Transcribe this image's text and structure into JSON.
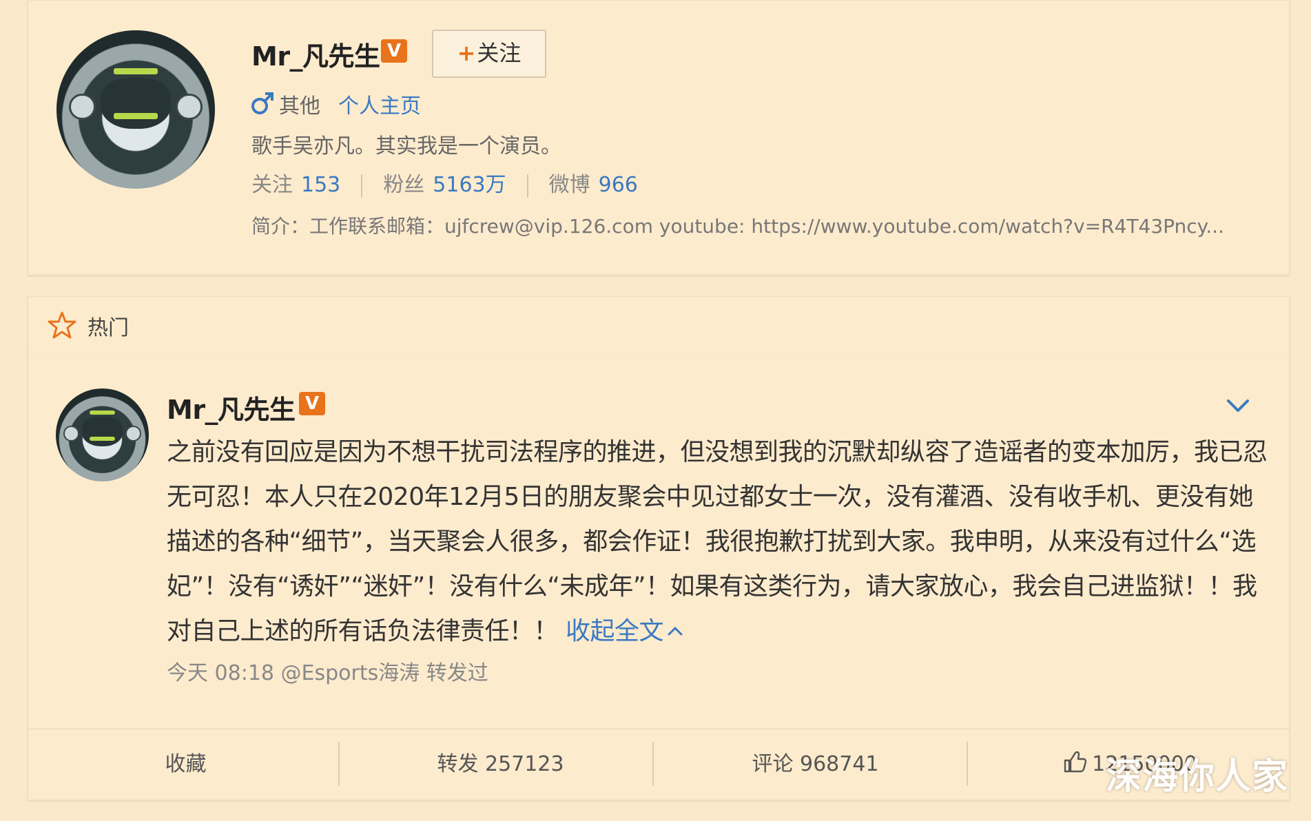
{
  "profile": {
    "name": "Mr_凡先生",
    "verified_badge": "V",
    "follow_button": {
      "plus": "+",
      "label": "关注"
    },
    "gender_icon": "male-icon",
    "gender_label": "其他",
    "homepage_link": "个人主页",
    "description": "歌手吴亦凡。其实我是一个演员。",
    "stats": [
      {
        "label": "关注",
        "value": "153"
      },
      {
        "label": "粉丝",
        "value": "5163万"
      },
      {
        "label": "微博",
        "value": "966"
      }
    ],
    "bio": "简介：工作联系邮箱：ujfcrew@vip.126.com youtube: https://www.youtube.com/watch?v=R4T43Pncy..."
  },
  "hot_section": {
    "icon": "star-icon",
    "label": "热门"
  },
  "post": {
    "author": "Mr_凡先生",
    "verified_badge": "V",
    "text": "之前没有回应是因为不想干扰司法程序的推进，但没想到我的沉默却纵容了造谣者的变本加厉，我已忍无可忍！本人只在2020年12月5日的朋友聚会中见过都女士一次，没有灌酒、没有收手机、更没有她描述的各种“细节”，当天聚会人很多，都会作证！我很抱歉打扰到大家。我申明，从来没有过什么“选妃”！没有“诱奸”“迷奸”！没有什么“未成年”！如果有这类行为，请大家放心，我会自己进监狱！！我对自己上述的所有话负法律责任！！",
    "collapse_link": "收起全文",
    "meta": "今天 08:18 @Esports海涛 转发过"
  },
  "actions": {
    "favorite": "收藏",
    "repost": "转发 257123",
    "comment": "评论 968741",
    "like": "12150000"
  },
  "watermark": "深海你人家",
  "colors": {
    "background": "#fbe9cb",
    "link": "#3a79c2",
    "badge": "#e8731b"
  }
}
